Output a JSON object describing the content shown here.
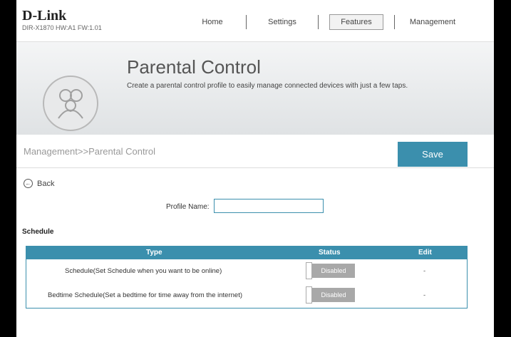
{
  "header": {
    "brand": "D-Link",
    "model": "DIR-X1870 HW:A1 FW:1.01",
    "nav": [
      "Home",
      "Settings",
      "Features",
      "Management"
    ]
  },
  "banner": {
    "title": "Parental Control",
    "description": "Create a parental control profile to easily manage connected devices with just a few taps."
  },
  "breadcrumb": "Management>>Parental Control",
  "save_label": "Save",
  "back_label": "Back",
  "profile": {
    "label": "Profile Name:",
    "value": ""
  },
  "schedule": {
    "title": "Schedule",
    "columns": [
      "Type",
      "Status",
      "Edit"
    ],
    "rows": [
      {
        "type": "Schedule(Set Schedule when you want to be online)",
        "status": "Disabled",
        "edit": "-"
      },
      {
        "type": "Bedtime Schedule(Set a bedtime for time away from the internet)",
        "status": "Disabled",
        "edit": "-"
      }
    ]
  }
}
